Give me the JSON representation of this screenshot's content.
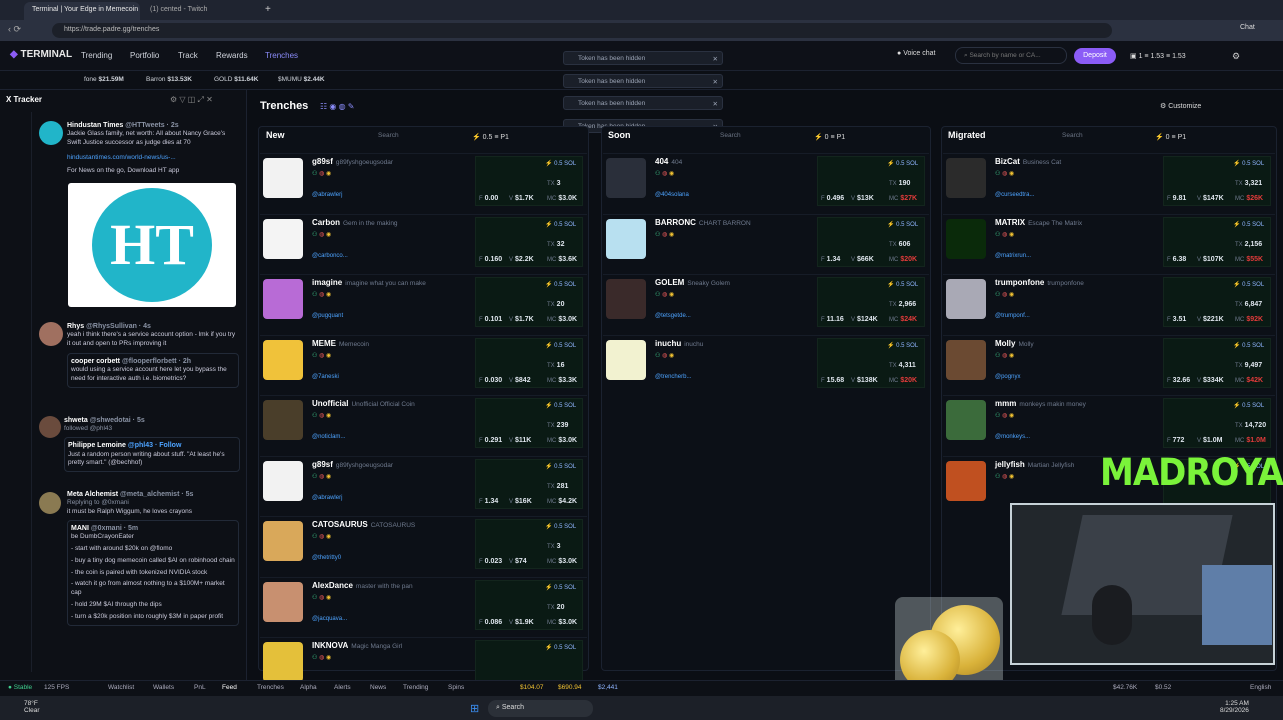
{
  "browser": {
    "tabs": [
      {
        "label": "Terminal | Your Edge in Memecoin"
      },
      {
        "label": "(1) cented - Twitch"
      }
    ],
    "url": "https://trade.padre.gg/trenches"
  },
  "nav": {
    "logo": "TERMINAL",
    "items": [
      "Trending",
      "Portfolio",
      "Track",
      "Rewards",
      "Trenches"
    ],
    "voice_chat": "Voice chat",
    "search_placeholder": "Search by name or CA...",
    "search_key": "/",
    "deposit": "Deposit",
    "wallet_count": "1",
    "balance1": "1.53",
    "balance2": "1.53"
  },
  "ticker": [
    {
      "name": "fone",
      "value": "$21.59M"
    },
    {
      "name": "Barron",
      "value": "$13.53K"
    },
    {
      "name": "GOLD",
      "value": "$11.64K"
    },
    {
      "name": "$MUMU",
      "value": "$2.44K"
    }
  ],
  "toasts": [
    "Token has been hidden",
    "Token has been hidden",
    "Token has been hidden",
    "Token has been hidden"
  ],
  "tracker": {
    "title": "X Tracker",
    "tweets": [
      {
        "author": "Hindustan Times",
        "handle": "@HTTweets · 2s",
        "text": "Jackie Glass family, net worth: All about Nancy Grace's Swift Justice successor as judge dies at 70",
        "link": "hindustantimes.com/world-news/us-...",
        "extra": "For News on the go, Download HT app",
        "image_text": "HT"
      },
      {
        "author": "Rhys",
        "handle": "@RhysSullivan · 4s",
        "text": "yeah i think there's a service account option - lmk if you try it out and open to PRs improving it",
        "quote_author": "cooper corbett",
        "quote_handle": "@flooperflorbett · 2h",
        "quote_text": "would using a service account here let you bypass the need for interactive auth i.e. biometrics?"
      },
      {
        "author": "shweta",
        "handle": "@shwedotai · 5s",
        "text": "followed @phl43",
        "quote_author": "Philippe Lemoine",
        "quote_handle": "@phl43 · Follow",
        "quote_text": "Just a random person writing about stuff. \"At least he's pretty smart.\" (@bechhof)"
      },
      {
        "author": "Meta Alchemist",
        "handle": "@meta_alchemist · 5s",
        "reply": "Replying to @0xmani",
        "text": "it must be Ralph Wiggum, he loves crayons",
        "quote_author": "MANI",
        "quote_handle": "@0xmani · 5m",
        "lines": [
          "be DumbCrayonEater",
          "- start with around $20k on @flomo",
          "- buy a tiny dog memecoin called $AI on robinhood chain",
          "- the coin is paired with tokenized NVIDIA stock",
          "- watch it go from almost nothing to a $100M+ market cap",
          "- hold 29M $AI through the dips",
          "- turn a $20k position into roughly $3M in paper profit"
        ]
      }
    ]
  },
  "trenches": {
    "title": "Trenches",
    "customize": "Customize",
    "columns": [
      {
        "title": "New",
        "search": "Search",
        "p": "P1",
        "count": "0.5",
        "tokens": [
          {
            "name": "g89sf",
            "sub": "g89fyshgoeugsodar",
            "handle": "@abrawlerj",
            "mc": "$3.0K",
            "v": "$1.7K",
            "tx": "3",
            "f": "0.00"
          },
          {
            "name": "Carbon",
            "sub": "Gem in the making",
            "handle": "@carbonco...",
            "mc": "$3.6K",
            "v": "$2.2K",
            "tx": "32",
            "f": "0.160"
          },
          {
            "name": "imagine",
            "sub": "imagine what you can make",
            "handle": "@pugquant",
            "mc": "$3.0K",
            "v": "$1.7K",
            "tx": "20",
            "f": "0.101"
          },
          {
            "name": "MEME",
            "sub": "Memecoin",
            "handle": "@7aneski",
            "mc": "$3.3K",
            "v": "$842",
            "tx": "16",
            "f": "0.030"
          },
          {
            "name": "Unofficial",
            "sub": "Unofficial Official Coin",
            "handle": "@noticlam...",
            "mc": "$3.0K",
            "v": "$11K",
            "tx": "239",
            "f": "0.291"
          },
          {
            "name": "g89sf",
            "sub": "g89fyshgoeugsodar",
            "handle": "@abrawlerj",
            "mc": "$4.2K",
            "v": "$16K",
            "tx": "281",
            "f": "1.34"
          },
          {
            "name": "CATOSAURUS",
            "sub": "CATOSAURUS",
            "handle": "@thetritty0",
            "mc": "$3.0K",
            "v": "$74",
            "tx": "3",
            "f": "0.023"
          },
          {
            "name": "AlexDance",
            "sub": "master with the pan",
            "handle": "@jacquava...",
            "mc": "$3.0K",
            "v": "$1.9K",
            "tx": "20",
            "f": "0.086"
          },
          {
            "name": "INKNOVA",
            "sub": "Magic Manga Girl",
            "handle": "",
            "mc": "",
            "v": "",
            "tx": "",
            "f": ""
          }
        ]
      },
      {
        "title": "Soon",
        "search": "Search",
        "p": "P1",
        "count": "0",
        "tokens": [
          {
            "name": "404",
            "sub": "404",
            "handle": "@404solana",
            "mc": "$27K",
            "v": "$13K",
            "tx": "190",
            "f": "0.496"
          },
          {
            "name": "BARRONC",
            "sub": "CHART BARRON",
            "handle": "",
            "mc": "$20K",
            "v": "$66K",
            "tx": "606",
            "f": "1.34"
          },
          {
            "name": "GOLEM",
            "sub": "Sneaky Golem",
            "handle": "@tetsgetde...",
            "mc": "$24K",
            "v": "$124K",
            "tx": "2,966",
            "f": "11.16"
          },
          {
            "name": "inuchu",
            "sub": "inuchu",
            "handle": "@trencherb...",
            "mc": "$20K",
            "v": "$138K",
            "tx": "4,311",
            "f": "15.68"
          }
        ]
      },
      {
        "title": "Migrated",
        "search": "Search",
        "p": "P1",
        "count": "0",
        "tokens": [
          {
            "name": "BizCat",
            "sub": "Business Cat",
            "handle": "@curseedtra...",
            "mc": "$26K",
            "v": "$147K",
            "tx": "3,321",
            "f": "9.81"
          },
          {
            "name": "MATRIX",
            "sub": "Escape The Matrix",
            "handle": "@matrixrun...",
            "mc": "$55K",
            "v": "$107K",
            "tx": "2,156",
            "f": "6.38"
          },
          {
            "name": "trumponfone",
            "sub": "trumponfone",
            "handle": "@trumponf...",
            "mc": "$92K",
            "v": "$221K",
            "tx": "6,847",
            "f": "3.51"
          },
          {
            "name": "Molly",
            "sub": "Molly",
            "handle": "@pognyx",
            "mc": "$42K",
            "v": "$334K",
            "tx": "9,497",
            "f": "32.66"
          },
          {
            "name": "mmm",
            "sub": "monkeys makin money",
            "handle": "@monkeys...",
            "mc": "$1.0M",
            "v": "$1.0M",
            "tx": "14,720",
            "f": "772"
          },
          {
            "name": "jellyfish",
            "sub": "Martian Jellyfish",
            "handle": "",
            "mc": "",
            "v": "",
            "tx": "",
            "f": ""
          }
        ]
      }
    ]
  },
  "footer": {
    "items": [
      "Stable",
      "125 FPS",
      "Watchlist",
      "Wallets",
      "PnL",
      "Feed",
      "Trenches",
      "Alpha",
      "Alerts",
      "News",
      "Trending",
      "Spins"
    ],
    "prices": [
      "$104.07",
      "$690.94",
      "$2,441"
    ],
    "right": [
      "$42.76K",
      "$0.52",
      "English"
    ]
  },
  "taskbar": {
    "weather": "78°F",
    "weather_sub": "Clear",
    "search": "Search",
    "time": "1:25 AM",
    "date": "8/29/2026"
  },
  "overlay": {
    "brand": "MADROYALS"
  }
}
